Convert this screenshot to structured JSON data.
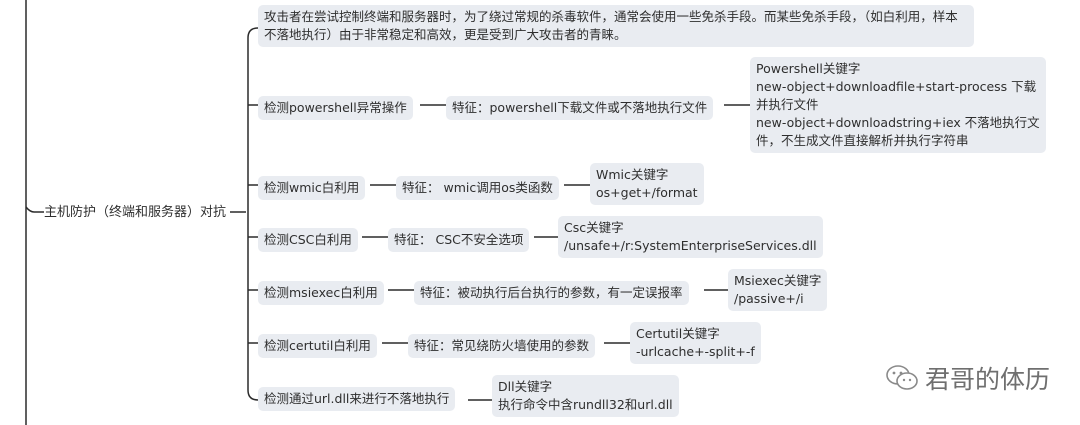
{
  "root": {
    "label": "主机防护（终端和服务器）对抗"
  },
  "intro": "攻击者在尝试控制终端和服务器时，为了绕过常规的杀毒软件，通常会使用一些免杀手段。而某些免杀手段，（如白利用，样本不落地执行）由于非常稳定和高效，更是受到广大攻击者的青睐。",
  "branches": [
    {
      "detect": "检测powershell异常操作",
      "feature": "特征：powershell下载文件或不落地执行文件",
      "keywords": "Powershell关键字\n new-object+downloadfile+start-process 下载并执行文件\n new-object+downloadstring+iex 不落地执行文件，不生成文件直接解析并执行字符串"
    },
    {
      "detect": "检测wmic白利用",
      "feature": "特征： wmic调用os类函数",
      "keywords": "Wmic关键字\n os+get+/format"
    },
    {
      "detect": "检测CSC白利用",
      "feature": "特征： CSC不安全选项",
      "keywords": "Csc关键字\n /unsafe+/r:SystemEnterpriseServices.dll"
    },
    {
      "detect": "检测msiexec白利用",
      "feature": "特征：被动执行后台执行的参数，有一定误报率",
      "keywords": "Msiexec关键字\n /passive+/i"
    },
    {
      "detect": "检测certutil白利用",
      "feature": "特征：常见绕防火墙使用的参数",
      "keywords": "Certutil关键字\n -urlcache+-split+-f"
    },
    {
      "detect": "检测通过url.dll来进行不落地执行",
      "feature": "",
      "keywords": "Dll关键字\n 执行命令中含rundll32和url.dll"
    }
  ],
  "watermark": {
    "text": "君哥的体历",
    "icon": "wechat-icon"
  },
  "colors": {
    "node_bg": "#e9ecf1",
    "line": "#2b2b2b",
    "watermark": "#6f6f6f"
  }
}
